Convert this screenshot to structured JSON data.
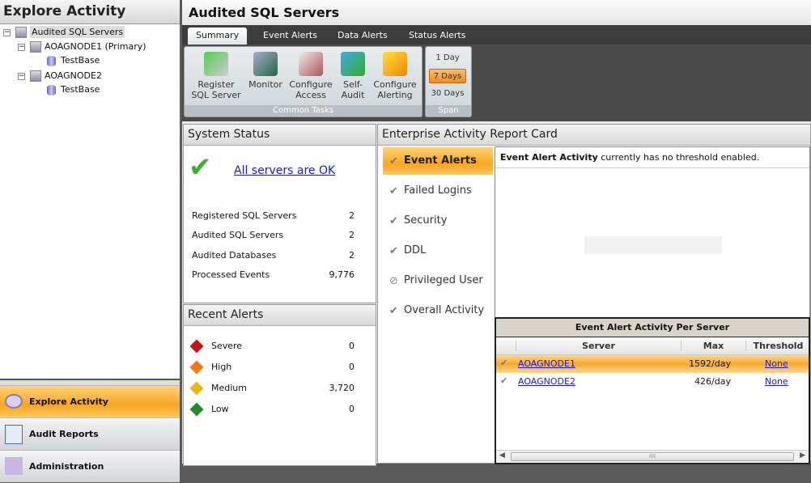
{
  "left": {
    "title": "Explore Activity",
    "tree": [
      {
        "label": "Audited SQL Servers"
      },
      {
        "label": "AOAGNODE1 (Primary)"
      },
      {
        "label": "TestBase"
      },
      {
        "label": "AOAGNODE2"
      },
      {
        "label": "TestBase"
      }
    ],
    "nav": [
      {
        "label": "Explore Activity"
      },
      {
        "label": "Audit Reports"
      },
      {
        "label": "Administration"
      }
    ]
  },
  "header": {
    "title": "Audited SQL Servers"
  },
  "tabs": [
    "Summary",
    "Event Alerts",
    "Data Alerts",
    "Status Alerts"
  ],
  "ribbon": {
    "common_tasks": "Common Tasks",
    "buttons": [
      [
        "Register",
        "SQL Server"
      ],
      [
        "Monitor",
        ""
      ],
      [
        "Configure",
        "Access"
      ],
      [
        "Self-",
        "Audit"
      ],
      [
        "Configure",
        "Alerting"
      ]
    ],
    "span_label": "Span",
    "spans": [
      "1 Day",
      "7 Days",
      "30 Days"
    ],
    "selected_span": "7 Days"
  },
  "system_status": {
    "title": "System Status",
    "ok_link": "All servers are OK",
    "rows": [
      [
        "Registered SQL Servers",
        "2"
      ],
      [
        "Audited SQL Servers",
        "2"
      ],
      [
        "Audited Databases",
        "2"
      ],
      [
        "Processed Events",
        "9,776"
      ]
    ]
  },
  "recent_alerts": {
    "title": "Recent Alerts",
    "rows": [
      {
        "label": "Severe",
        "value": "0",
        "color": "#c0161b"
      },
      {
        "label": "High",
        "value": "0",
        "color": "#f07a10"
      },
      {
        "label": "Medium",
        "value": "3,720",
        "color": "#e8b818"
      },
      {
        "label": "Low",
        "value": "0",
        "color": "#2a8a2a"
      }
    ]
  },
  "report_card": {
    "title": "Enterprise Activity Report Card",
    "items": [
      "Event Alerts",
      "Failed Logins",
      "Security",
      "DDL",
      "Privileged User",
      "Overall Activity"
    ],
    "message_bold": "Event Alert Activity",
    "message_rest": " currently has no threshold enabled.",
    "table": {
      "title": "Event Alert Activity Per Server",
      "columns": [
        "Server",
        "Max",
        "Threshold"
      ],
      "rows": [
        [
          "AOAGNODE1",
          "1592/day",
          "None"
        ],
        [
          "AOAGNODE2",
          "426/day",
          "None"
        ]
      ],
      "scroll_grip": "IIII"
    }
  }
}
